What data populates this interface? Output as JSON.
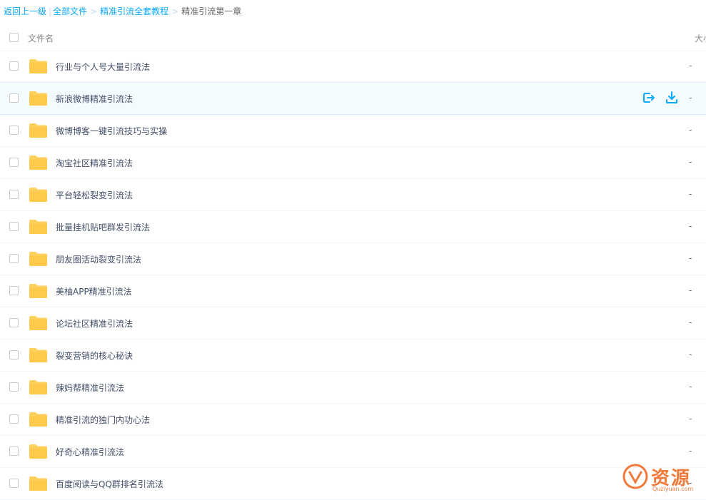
{
  "breadcrumb": {
    "back": "返回上一级",
    "all_files": "全部文件",
    "parent": "精准引流全套教程",
    "current": "精准引流第一章",
    "separator": ">",
    "pipe": "|"
  },
  "table": {
    "header": {
      "name": "文件名",
      "size": "大小"
    },
    "rows": [
      {
        "name": "行业与个人号大量引流法",
        "size": "-"
      },
      {
        "name": "新浪微博精准引流法",
        "size": "-"
      },
      {
        "name": "微博博客一键引流技巧与实操",
        "size": "-"
      },
      {
        "name": "淘宝社区精准引流法",
        "size": "-"
      },
      {
        "name": "平台轻松裂变引流法",
        "size": "-"
      },
      {
        "name": "批量挂机贴吧群发引流法",
        "size": "-"
      },
      {
        "name": "朋友圈活动裂变引流法",
        "size": "-"
      },
      {
        "name": "美柚APP精准引流法",
        "size": "-"
      },
      {
        "name": "论坛社区精准引流法",
        "size": "-"
      },
      {
        "name": "裂变营销的核心秘诀",
        "size": "-"
      },
      {
        "name": "辣妈帮精准引流法",
        "size": "-"
      },
      {
        "name": "精准引流的独门内功心法",
        "size": "-"
      },
      {
        "name": "好奇心精准引流法",
        "size": "-"
      },
      {
        "name": "百度阅读与QQ群排名引流法",
        "size": "-"
      }
    ]
  },
  "icons": {
    "folder": "folder-icon",
    "share": "share-icon",
    "download": "download-icon"
  },
  "watermark": {
    "title": "资源",
    "url": "Quziyuan.com"
  },
  "colors": {
    "accent": "#09aaff",
    "folder": "#ffd15c",
    "watermark": "#f07a3a"
  }
}
